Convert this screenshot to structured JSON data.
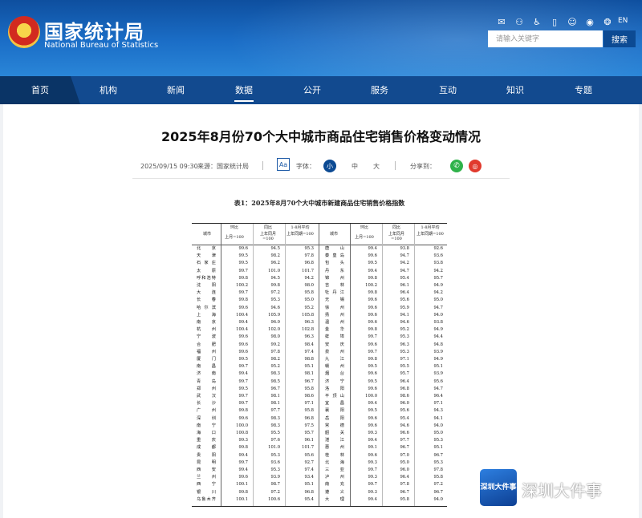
{
  "site": {
    "name_cn": "国家统计局",
    "name_en": "National Bureau of Statistics",
    "search_placeholder": "请输入关键字",
    "search_button": "搜索",
    "lang": "EN",
    "top_icons": [
      "mail-icon",
      "user-icon",
      "accessibility-icon",
      "mobile-icon",
      "elder-mode-icon",
      "weibo-icon",
      "wechat-icon"
    ]
  },
  "nav": {
    "items": [
      "首页",
      "机构",
      "新闻",
      "数据",
      "公开",
      "服务",
      "互动",
      "知识",
      "专题"
    ],
    "active": "数据"
  },
  "article": {
    "title": "2025年8月份70个大中城市商品住宅销售价格变动情况",
    "datetime": "2025/09/15 09:30",
    "source": "来源：国家统计局",
    "font_icon": "Aa",
    "font_label": "字体：",
    "font_small": "小",
    "font_medium": "中",
    "font_large": "大",
    "share_label": "分享到："
  },
  "table": {
    "caption": "表1：2025年8月70个大中城市新建商品住宅销售价格指数",
    "headers": {
      "city": "城市",
      "mom": "环比",
      "mom_base": "上月=100",
      "yoy": "同比",
      "yoy_base": "上年同月=100",
      "ytd": "1-8月平均",
      "ytd_base": "上年同期=100"
    },
    "left_rows": [
      [
        "北　京",
        "99.6",
        "94.5",
        "95.3"
      ],
      [
        "天　津",
        "99.5",
        "98.2",
        "97.8"
      ],
      [
        "石家庄",
        "99.5",
        "96.2",
        "96.8"
      ],
      [
        "太　原",
        "99.7",
        "101.0",
        "101.7"
      ],
      [
        "呼和浩特",
        "99.8",
        "94.5",
        "94.2"
      ],
      [
        "沈　阳",
        "100.2",
        "99.8",
        "98.0"
      ],
      [
        "大　连",
        "99.7",
        "97.2",
        "95.8"
      ],
      [
        "长　春",
        "99.8",
        "95.3",
        "95.0"
      ],
      [
        "哈尔滨",
        "99.6",
        "94.6",
        "95.2"
      ],
      [
        "上　海",
        "100.4",
        "105.9",
        "105.8"
      ],
      [
        "南　京",
        "99.4",
        "96.0",
        "96.3"
      ],
      [
        "杭　州",
        "100.4",
        "102.0",
        "102.8"
      ],
      [
        "宁　波",
        "99.6",
        "98.0",
        "96.3"
      ],
      [
        "合　肥",
        "99.6",
        "99.2",
        "98.4"
      ],
      [
        "福　州",
        "99.6",
        "97.8",
        "97.4"
      ],
      [
        "厦　门",
        "99.5",
        "98.2",
        "98.8"
      ],
      [
        "南　昌",
        "99.7",
        "95.2",
        "95.1"
      ],
      [
        "济　南",
        "99.4",
        "98.3",
        "98.1"
      ],
      [
        "青　岛",
        "99.7",
        "98.5",
        "96.7"
      ],
      [
        "郑　州",
        "99.5",
        "96.7",
        "95.8"
      ],
      [
        "武　汉",
        "99.7",
        "98.1",
        "98.6"
      ],
      [
        "长　沙",
        "99.7",
        "98.1",
        "97.1"
      ],
      [
        "广　州",
        "99.8",
        "97.7",
        "95.8"
      ],
      [
        "深　圳",
        "99.6",
        "98.3",
        "96.8"
      ],
      [
        "南　宁",
        "100.0",
        "98.3",
        "97.5"
      ],
      [
        "海　口",
        "100.8",
        "95.5",
        "95.7"
      ],
      [
        "重　庆",
        "99.3",
        "97.6",
        "96.1"
      ],
      [
        "成　都",
        "99.8",
        "101.0",
        "101.7"
      ],
      [
        "贵　阳",
        "99.4",
        "95.3",
        "95.6"
      ],
      [
        "昆　明",
        "99.7",
        "93.6",
        "92.7"
      ],
      [
        "西　安",
        "99.4",
        "95.3",
        "97.4"
      ],
      [
        "兰　州",
        "99.6",
        "93.9",
        "93.4"
      ],
      [
        "西　宁",
        "100.1",
        "98.7",
        "95.1"
      ],
      [
        "银　川",
        "99.8",
        "97.2",
        "96.8"
      ],
      [
        "乌鲁木齐",
        "100.1",
        "100.6",
        "95.4"
      ]
    ],
    "right_rows": [
      [
        "唐　山",
        "99.4",
        "93.8",
        "92.6"
      ],
      [
        "秦皇岛",
        "99.6",
        "94.7",
        "93.6"
      ],
      [
        "包　头",
        "99.5",
        "94.2",
        "93.8"
      ],
      [
        "丹　东",
        "99.4",
        "94.7",
        "94.2"
      ],
      [
        "锦　州",
        "99.8",
        "95.4",
        "95.7"
      ],
      [
        "吉　林",
        "100.2",
        "96.1",
        "94.9"
      ],
      [
        "牡丹江",
        "99.8",
        "96.4",
        "94.2"
      ],
      [
        "无　锡",
        "99.6",
        "95.6",
        "95.0"
      ],
      [
        "徐　州",
        "99.6",
        "95.9",
        "94.7"
      ],
      [
        "扬　州",
        "99.6",
        "94.1",
        "94.0"
      ],
      [
        "温　州",
        "99.6",
        "94.6",
        "93.8"
      ],
      [
        "金　华",
        "99.8",
        "95.2",
        "94.9"
      ],
      [
        "蚌　埠",
        "99.7",
        "95.3",
        "94.4"
      ],
      [
        "安　庆",
        "99.6",
        "96.3",
        "94.8"
      ],
      [
        "泉　州",
        "99.7",
        "95.3",
        "93.9"
      ],
      [
        "九　江",
        "99.8",
        "97.1",
        "94.9"
      ],
      [
        "赣　州",
        "99.5",
        "95.5",
        "95.1"
      ],
      [
        "烟　台",
        "99.6",
        "95.7",
        "93.9"
      ],
      [
        "济　宁",
        "99.5",
        "96.4",
        "95.6"
      ],
      [
        "洛　阳",
        "99.6",
        "96.8",
        "94.7"
      ],
      [
        "平顶山",
        "100.0",
        "98.6",
        "96.4"
      ],
      [
        "宜　昌",
        "99.4",
        "96.0",
        "97.1"
      ],
      [
        "襄　阳",
        "99.5",
        "95.6",
        "94.3"
      ],
      [
        "岳　阳",
        "99.6",
        "95.4",
        "94.1"
      ],
      [
        "常　德",
        "99.6",
        "94.6",
        "94.0"
      ],
      [
        "韶　关",
        "99.3",
        "96.6",
        "95.0"
      ],
      [
        "湛　江",
        "99.4",
        "97.7",
        "95.3"
      ],
      [
        "惠　州",
        "99.1",
        "96.7",
        "95.1"
      ],
      [
        "桂　林",
        "99.6",
        "97.0",
        "96.7"
      ],
      [
        "北　海",
        "99.3",
        "95.0",
        "95.3"
      ],
      [
        "三　亚",
        "99.7",
        "96.0",
        "97.8"
      ],
      [
        "泸　州",
        "99.3",
        "96.4",
        "95.8"
      ],
      [
        "南　充",
        "99.7",
        "97.8",
        "97.2"
      ],
      [
        "遵　义",
        "99.3",
        "96.7",
        "96.7"
      ],
      [
        "大　理",
        "99.4",
        "95.8",
        "94.0"
      ]
    ]
  },
  "watermark": {
    "badge": "深圳大件事",
    "text": "深圳大件事"
  }
}
